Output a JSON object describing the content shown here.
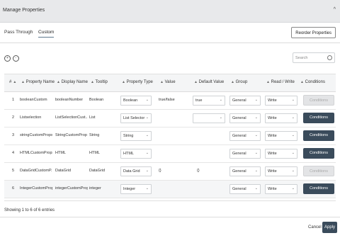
{
  "dialog": {
    "title": "Manage Properties",
    "collapse_glyph": "^"
  },
  "tabs": [
    {
      "label": "Pass Through",
      "active": false
    },
    {
      "label": "Custom",
      "active": true
    }
  ],
  "reorder_button": "Reorder Properties",
  "row_controls": {
    "add_glyph": "+",
    "remove_glyph": "-"
  },
  "search": {
    "placeholder": "Search"
  },
  "columns": {
    "num": "#",
    "sort_glyph": "▲",
    "property_name": "Property Name",
    "display_name": "Display Name",
    "tooltip": "Tooltip",
    "property_type": "Property Type",
    "value": "Value",
    "default_value": "Default Value",
    "group": "Group",
    "read_write": "Read / Write",
    "conditions": "Conditions"
  },
  "rows": [
    {
      "num": "1",
      "property_name": "booleanCustom",
      "display_name": "booleanNumber",
      "tooltip": "Boolean",
      "property_type": "Boolean",
      "value": "true/false",
      "default_value": "true",
      "group": "General",
      "read_write": "Write",
      "conditions": "Conditions",
      "conditions_enabled": false
    },
    {
      "num": "2",
      "property_name": "Listselection",
      "display_name": "ListSelectionCust...",
      "tooltip": "List",
      "property_type": "List Selector",
      "value": "",
      "default_value": "",
      "group": "General",
      "read_write": "Write",
      "conditions": "Conditions",
      "conditions_enabled": true
    },
    {
      "num": "3",
      "property_name": "stringCustomProps",
      "display_name": "StringCustomProp",
      "tooltip": "String",
      "property_type": "String",
      "value": "",
      "default_value": "",
      "group": "General",
      "read_write": "Write",
      "conditions": "Conditions",
      "conditions_enabled": true
    },
    {
      "num": "4",
      "property_name": "HTMLCustomProps",
      "display_name": "HTML",
      "tooltip": "HTML",
      "property_type": "HTML",
      "value": "",
      "default_value": "",
      "group": "General",
      "read_write": "Write",
      "conditions": "Conditions",
      "conditions_enabled": true
    },
    {
      "num": "5",
      "property_name": "DataGridCustomP...",
      "display_name": "DataGrid",
      "tooltip": "DataGrid",
      "property_type": "Data Grid",
      "value": "{}",
      "default_value": "{}",
      "group": "General",
      "read_write": "Write",
      "conditions": "Conditions",
      "conditions_enabled": false
    },
    {
      "num": "6",
      "property_name": "IntegerCustomProps",
      "display_name": "integerCustomProps",
      "tooltip": "integer",
      "property_type": "Integer",
      "value": "",
      "default_value": "",
      "group": "General",
      "read_write": "Write",
      "conditions": "Conditions",
      "conditions_enabled": true
    }
  ],
  "footer": {
    "entries_text": "Showing 1 to 6 of 6 entries",
    "cancel": "Cancel",
    "apply": "Apply"
  },
  "colors": {
    "primary": "#3a4b5b",
    "header_bg": "#e8e9eb",
    "table_head_bg": "#f4f5f6"
  }
}
